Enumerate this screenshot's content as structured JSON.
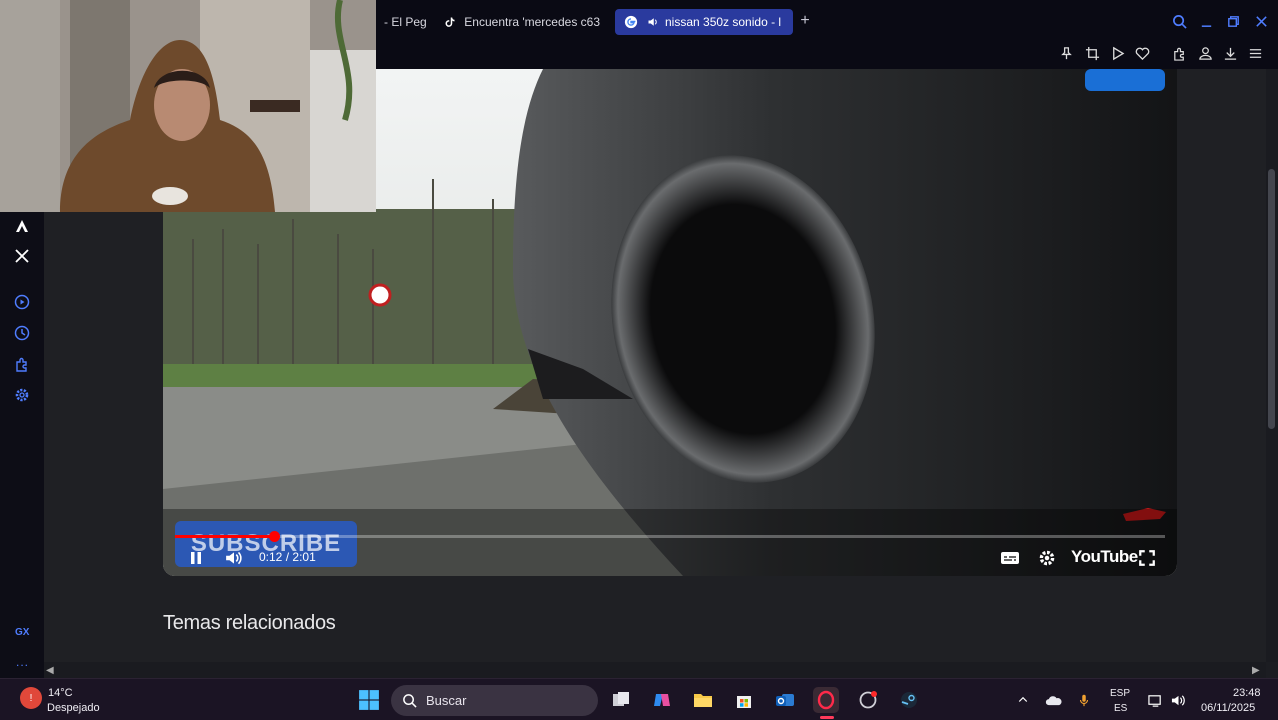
{
  "browser": {
    "tabs": [
      {
        "label": "- El Peg",
        "active": false
      },
      {
        "label": "Encuentra 'mercedes c63",
        "active": false,
        "icon": "tiktok-icon"
      },
      {
        "label": "nissan 350z sonido - l",
        "active": true,
        "icon": "google-icon"
      }
    ],
    "new_tab_symbol": "+",
    "accent": "#2a3a9e"
  },
  "video": {
    "time_current": "0:12",
    "time_separator": "/",
    "time_total": "2:01",
    "progress_fraction": 0.1,
    "overlay_text": "SUBSCRIBE",
    "brand_label": "YouTube",
    "progress_color": "#ff0000"
  },
  "page": {
    "related_heading": "Temas relacionados"
  },
  "sidebar": {
    "bottom_label": "GX",
    "more_label": "..."
  },
  "taskbar": {
    "weather_temp": "14°C",
    "weather_desc": "Despejado",
    "search_placeholder": "Buscar",
    "lang_top": "ESP",
    "lang_bottom": "ES",
    "time": "23:48",
    "date": "06/11/2025"
  }
}
